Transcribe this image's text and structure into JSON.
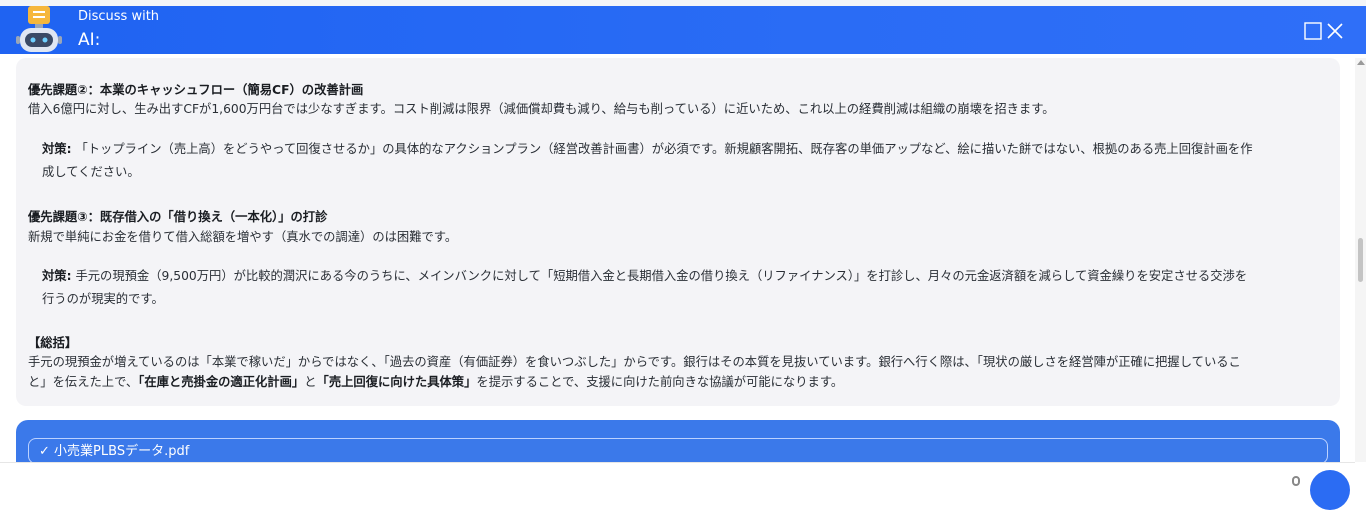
{
  "header": {
    "title_line1": "Discuss with",
    "title_line2": "AI:",
    "accent_color": "#2b6cf3"
  },
  "content": {
    "p1_heading": "優先課題②：本業のキャッシュフロー（簡易CF）の改善計画",
    "p1_text": "借入6億円に対し、生み出すCFが1,600万円台では少なすぎます。コスト削減は限界（減価償却費も減り、給与も削っている）に近いため、これ以上の経費削減は組織の崩壊を招きます。",
    "p1_measure_label": "対策:",
    "p1_measure_line1": "「トップライン（売上高）をどうやって回復させるか」の具体的なアクションプラン（経営改善計画書）が必須です。新規顧客開拓、既存客の単価アップなど、絵に描いた餅ではない、根拠のある売上回復計画を作",
    "p1_measure_line2": "成してください。",
    "p2_heading": "優先課題③：既存借入の「借り換え（一本化）」の打診",
    "p2_text": "新規で単純にお金を借りて借入総額を増やす（真水での調達）のは困難です。",
    "p2_measure_label": "対策:",
    "p2_measure_line1": "手元の現預金（9,500万円）が比較的潤沢にある今のうちに、メインバンクに対して「短期借入金と長期借入金の借り換え（リファイナンス）」を打診し、月々の元金返済額を減らして資金繰りを安定させる交渉を",
    "p2_measure_line2": "行うのが現実的です。",
    "summary_heading": "【総括】",
    "summary_line1": "手元の現預金が増えているのは「本業で稼いだ」からではなく、「過去の資産（有価証券）を食いつぶした」からです。銀行はその本質を見抜いています。銀行へ行く際は、「現状の厳しさを経営陣が正確に把握しているこ",
    "summary_line2_a": "と」を伝えた上で、",
    "summary_line2_b": "「在庫と売掛金の適正化計画」",
    "summary_line2_c": "と",
    "summary_line2_d": "「売上回復に向けた具体策」",
    "summary_line2_e": "を提示することで、支援に向けた前向きな協議が可能になります。"
  },
  "attachment": {
    "check": "✓",
    "file_name": "小売業PLBSデータ.pdf"
  },
  "icons": {
    "avatar": "robot-avatar-icon",
    "maximize": "maximize-icon",
    "close": "close-icon",
    "attach": "paperclip-icon",
    "send": "send-icon"
  }
}
